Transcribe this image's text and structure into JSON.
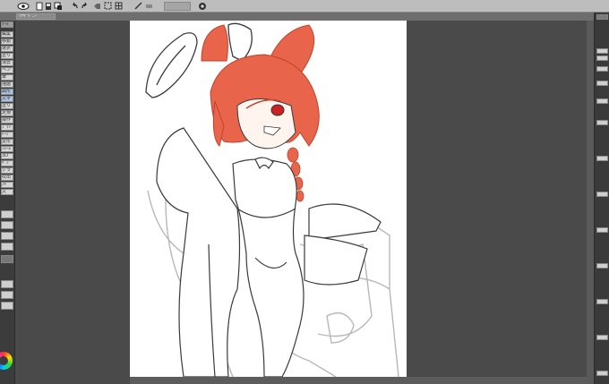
{
  "toolbar": {
    "icons": [
      "eye-icon",
      "new-file-icon",
      "save-icon",
      "color-swatch-icon",
      "undo-icon",
      "redo-icon",
      "clear-icon",
      "transform-icon",
      "grid-icon",
      "snap-icon",
      "ruler-icon",
      "brush-icon",
      "settings-icon"
    ]
  },
  "document": {
    "tab_label": "ｳｻｷﾞﾊﾞﾆｰ"
  },
  "left_panel": {
    "title": "ﾂｰﾙ",
    "items": [
      "編集",
      "移動",
      "選択",
      "塗り",
      "消去",
      "ペン",
      "筆",
      "描画",
      "図形",
      "文字",
      "塗り",
      "定規",
      "操作",
      "ﾌﾞﾗｼ",
      "ﾄｰﾝ",
      "変形",
      "ﾌﾚｰﾑ",
      "3D",
      "ﾍﾟﾝ",
      "グラ",
      "吹出",
      "ﾌｷ",
      "文"
    ]
  },
  "right_panel": {
    "items": [
      "ﾚｲﾔｰ",
      "ﾌﾟﾛﾊﾟ",
      "素材",
      "ﾅﾋﾞ"
    ]
  },
  "colors": {
    "panel_bg": "#3c3c3c",
    "workspace_bg": "#4a4a4a",
    "canvas_bg": "#ffffff",
    "hair": "#e8644a",
    "hair_dark": "#c0432b",
    "line": "#3a3a3a",
    "sketch": "#b8b8b8"
  }
}
